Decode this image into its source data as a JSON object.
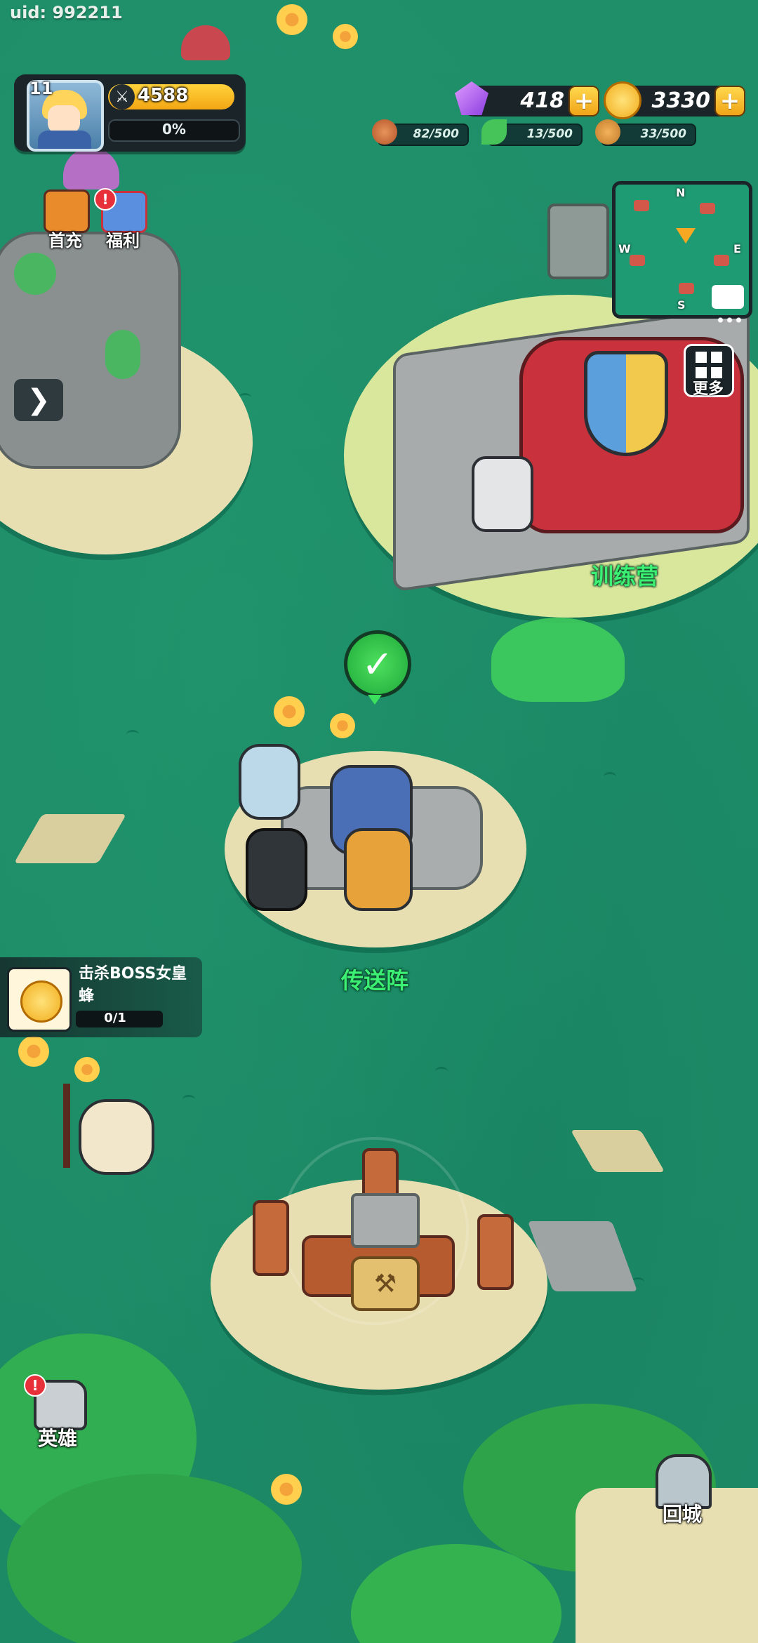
{
  "uid_label": "uid: 992211",
  "player": {
    "level": "11",
    "power": "4588",
    "exp_percent": "0%"
  },
  "currencies": {
    "gems": "418",
    "gold": "3330"
  },
  "resources": {
    "meat": "82/500",
    "wood_leaf": "13/500",
    "timber": "33/500"
  },
  "left_menu": [
    {
      "label": "首充"
    },
    {
      "label": "福利"
    }
  ],
  "minimap": {
    "n": "N",
    "e": "E",
    "s": "S",
    "w": "W"
  },
  "more_label": "更多",
  "locations": {
    "training_camp": "训练营",
    "teleport": "传送阵"
  },
  "quest": {
    "title": "击杀BOSS女皇蜂",
    "progress": "0/1"
  },
  "bottom": {
    "hero_label": "英雄",
    "return_label": "回城"
  },
  "badge_mark": "!",
  "colors": {
    "grass": "#1f8f6a",
    "label_green": "#3cf073",
    "gold": "#f3a614",
    "panel": "#1b2428"
  }
}
